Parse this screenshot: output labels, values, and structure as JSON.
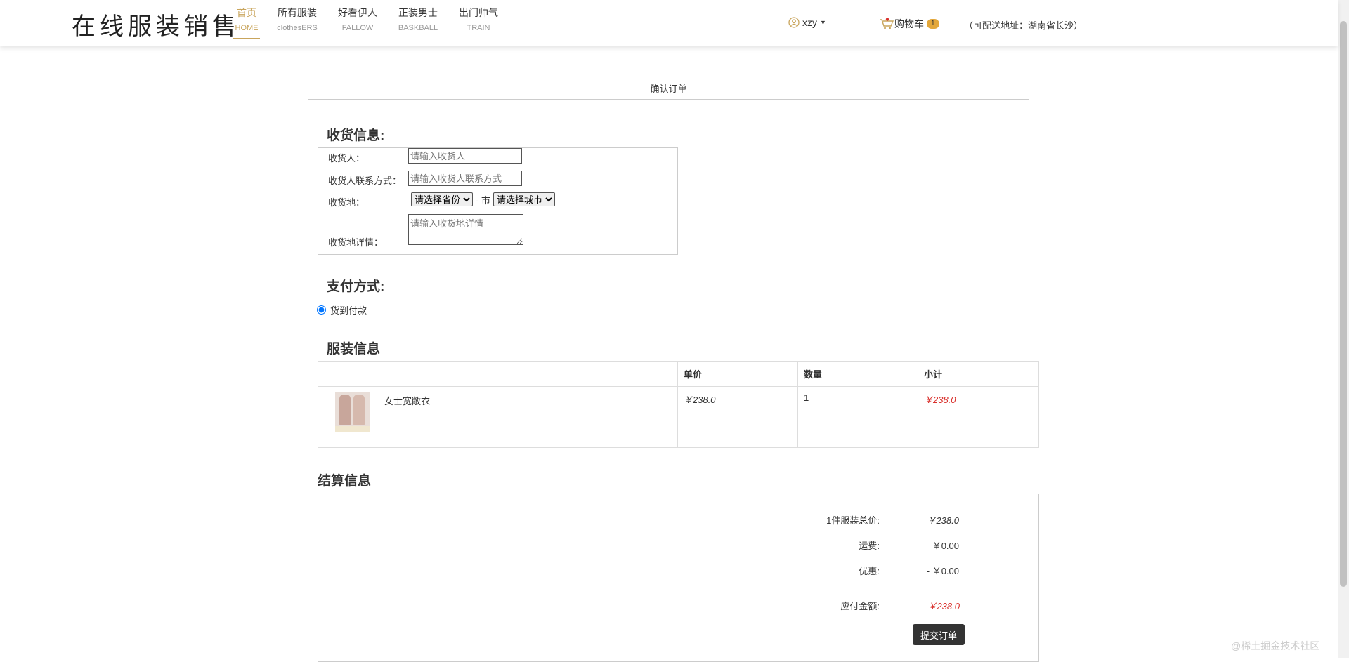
{
  "header": {
    "logo": "在线服装销售",
    "nav": [
      {
        "cn": "首页",
        "en": "HOME"
      },
      {
        "cn": "所有服装",
        "en": "clothesERS"
      },
      {
        "cn": "好看伊人",
        "en": "FALLOW"
      },
      {
        "cn": "正装男士",
        "en": "BASKBALL"
      },
      {
        "cn": "出门帅气",
        "en": "TRAIN"
      }
    ],
    "user": "xzy",
    "cart_label": "购物车",
    "cart_count": "1",
    "delivery": "（可配送地址：湖南省长沙）"
  },
  "page_title": "确认订单",
  "receiver": {
    "heading": "收货信息:",
    "name_label": "收货人：",
    "name_placeholder": "请输入收货人",
    "phone_label": "收货人联系方式：",
    "phone_placeholder": "请输入收货人联系方式",
    "place_label": "收货地：",
    "province": "请选择省份",
    "dash": "- 市",
    "city": "请选择城市",
    "detail_label": "收货地详情：",
    "detail_placeholder": "请输入收货地详情"
  },
  "payment": {
    "heading": "支付方式:",
    "option": "货到付款"
  },
  "goods": {
    "heading": "服装信息",
    "columns": [
      "",
      "单价",
      "数量",
      "小计"
    ],
    "items": [
      {
        "name": "女士宽敞衣",
        "price": "￥238.0",
        "qty": "1",
        "subtotal": "￥238.0"
      }
    ]
  },
  "settlement": {
    "heading": "结算信息",
    "total_label": "1件服装总价:",
    "total": "￥238.0",
    "shipping_label": "运费:",
    "shipping": "￥0.00",
    "discount_label": "优惠:",
    "discount": "- ￥0.00",
    "payable_label": "应付金额:",
    "payable": "￥238.0",
    "submit": "提交订单"
  },
  "watermark": "@稀土掘金技术社区",
  "colors": {
    "accent": "#c9a55c",
    "price_red": "#d9302c",
    "badge": "#e3a73a"
  }
}
